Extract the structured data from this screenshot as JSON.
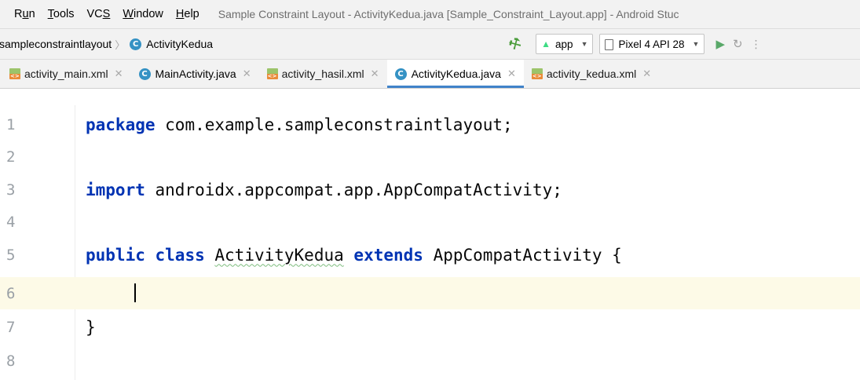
{
  "menubar": {
    "items": [
      {
        "prefix": "R",
        "mnemonic": "u",
        "suffix": "n"
      },
      {
        "prefix": "",
        "mnemonic": "T",
        "suffix": "ools"
      },
      {
        "prefix": "VC",
        "mnemonic": "S",
        "suffix": ""
      },
      {
        "prefix": "",
        "mnemonic": "W",
        "suffix": "indow"
      },
      {
        "prefix": "",
        "mnemonic": "H",
        "suffix": "elp"
      }
    ],
    "window_title": "Sample Constraint Layout - ActivityKedua.java [Sample_Constraint_Layout.app] - Android Stuc"
  },
  "navbar": {
    "breadcrumb": [
      "sampleconstraintlayout",
      "ActivityKedua"
    ],
    "class_badge": "C",
    "run_config": "app",
    "device": "Pixel 4 API 28"
  },
  "tabs": [
    {
      "label": "activity_main.xml",
      "type": "xml",
      "active": false
    },
    {
      "label": "MainActivity.java",
      "type": "java",
      "active": false
    },
    {
      "label": "activity_hasil.xml",
      "type": "xml",
      "active": false
    },
    {
      "label": "ActivityKedua.java",
      "type": "java",
      "active": true
    },
    {
      "label": "activity_kedua.xml",
      "type": "xml",
      "active": false
    }
  ],
  "editor": {
    "current_line": 6,
    "lines": [
      {
        "number": "1",
        "kw1": "package",
        "text": " com.example.sampleconstraintlayout;"
      },
      {
        "number": "2"
      },
      {
        "number": "3",
        "kw1": "import",
        "text": " androidx.appcompat.app.AppCompatActivity;"
      },
      {
        "number": "4"
      },
      {
        "number": "5",
        "kw1": "public",
        "kw2": "class",
        "name": "ActivityKedua",
        "kw3": "extends",
        "text": " AppCompatActivity {"
      },
      {
        "number": "6"
      },
      {
        "number": "7",
        "text": "}"
      },
      {
        "number": "8"
      }
    ]
  },
  "colors": {
    "keyword": "#0033b3",
    "current_line_bg": "#fdfae7",
    "active_tab_underline": "#4083c9",
    "class_badge": "#3592c4",
    "run_green": "#59a869"
  }
}
